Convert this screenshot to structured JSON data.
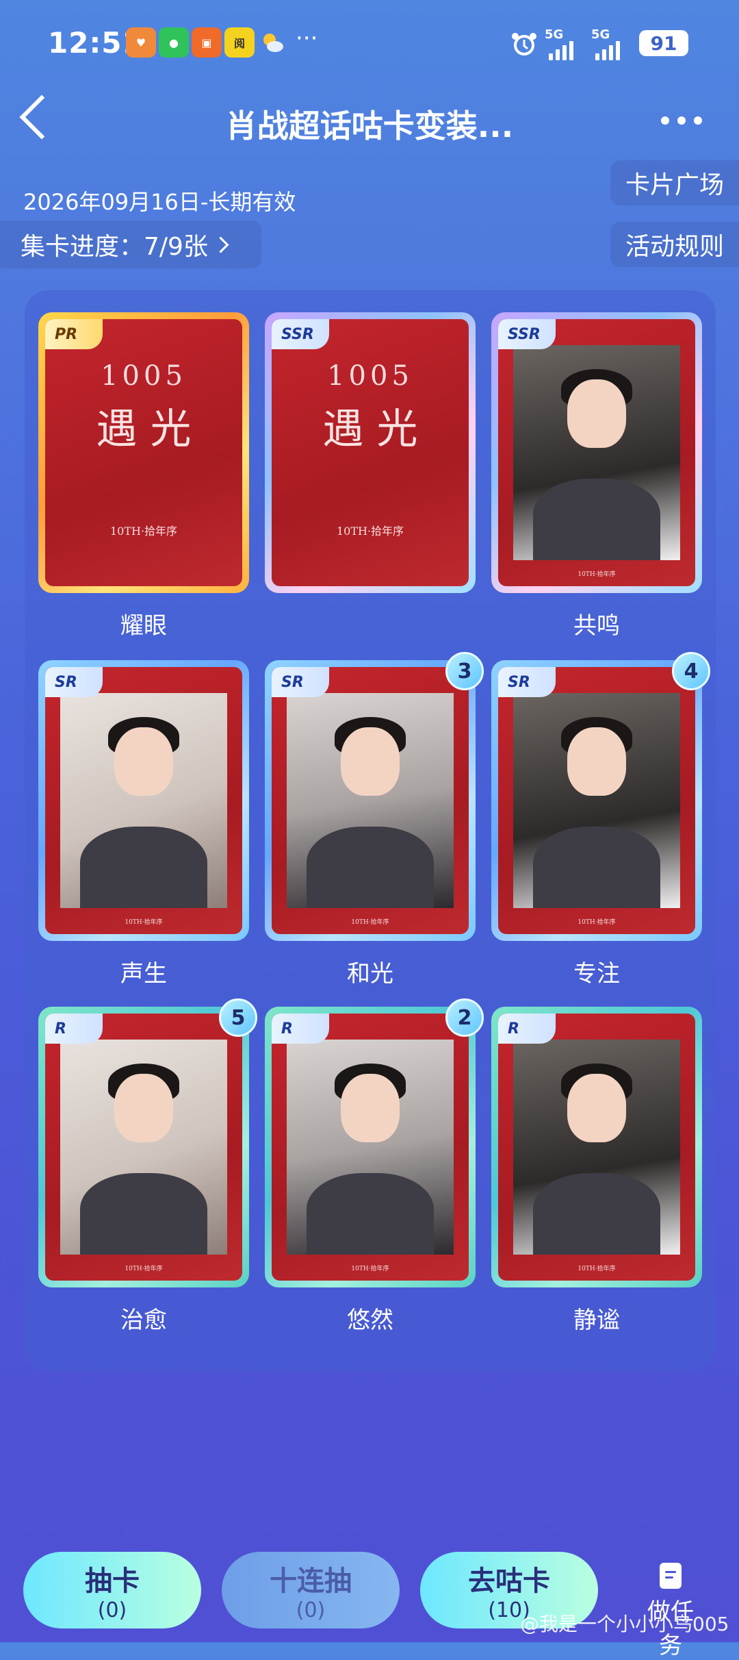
{
  "status_bar": {
    "time": "12:51",
    "app_icons": [
      "health-app-icon",
      "wechat-icon",
      "red-envelope-icon",
      "reading-app-icon",
      "weather-icon"
    ],
    "overflow": "···",
    "network1": "5G",
    "network2": "5G",
    "battery": "91"
  },
  "header": {
    "title": "肖战超话咕卡变装...",
    "date": "2026年09月16日-长期有效",
    "progress": "集卡进度：7/9张",
    "card_plaza": "卡片广场",
    "rules": "活动规则"
  },
  "cards": [
    {
      "rarity": "PR",
      "label": "耀眼",
      "count": "",
      "type": "poster",
      "poster_main": "遇 光",
      "poster_num": "1005",
      "poster_sub": "10TH·拾年序"
    },
    {
      "rarity": "SSR",
      "label": "",
      "count": "",
      "type": "poster",
      "poster_main": "遇 光",
      "poster_num": "1005",
      "poster_sub": "10TH·拾年序"
    },
    {
      "rarity": "SSR",
      "label": "共鸣",
      "count": "",
      "type": "photo",
      "foot": "10TH·拾年序"
    },
    {
      "rarity": "SR",
      "label": "声生",
      "count": "",
      "type": "photo",
      "foot": "10TH·拾年序"
    },
    {
      "rarity": "SR",
      "label": "和光",
      "count": "3",
      "type": "photo",
      "foot": "10TH·拾年序"
    },
    {
      "rarity": "SR",
      "label": "专注",
      "count": "4",
      "type": "photo",
      "foot": "10TH·拾年序"
    },
    {
      "rarity": "R",
      "label": "治愈",
      "count": "5",
      "type": "photo",
      "foot": "10TH·拾年序"
    },
    {
      "rarity": "R",
      "label": "悠然",
      "count": "2",
      "type": "photo",
      "foot": "10TH·拾年序"
    },
    {
      "rarity": "R",
      "label": "静谧",
      "count": "",
      "type": "photo",
      "foot": "10TH·拾年序"
    }
  ],
  "bottom": {
    "draw": {
      "label": "抽卡",
      "count": "(0)"
    },
    "draw10": {
      "label": "十连抽",
      "count": "(0)"
    },
    "guka": {
      "label": "去咕卡",
      "count": "(10)"
    },
    "task": "做任务"
  },
  "watermark": "@我是一个小小小鸟005",
  "colors": {
    "accent": "#6ee7ff",
    "card_red": "#b81f27",
    "rarity_pr": "#ffd84a",
    "rarity_ssr": "#c7a6ff",
    "rarity_sr": "#8fd4ff",
    "rarity_r": "#7fe7c8"
  }
}
